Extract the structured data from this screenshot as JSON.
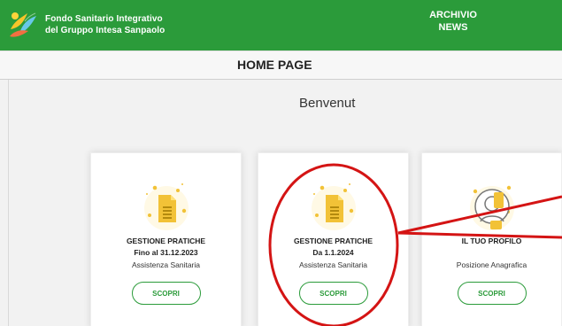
{
  "header": {
    "brand_line_1": "Fondo Sanitario Integrativo",
    "brand_line_2": "del Gruppo Intesa Sanpaolo",
    "nav_line_1": "ARCHIVIO",
    "nav_line_2": "NEWS"
  },
  "homebar": {
    "title": "HOME PAGE"
  },
  "main": {
    "welcome": "Benvenut"
  },
  "cards": [
    {
      "title": "GESTIONE PRATICHE",
      "subtitle": "Fino al 31.12.2023",
      "description": "Assistenza Sanitaria",
      "button": "SCOPRI",
      "icon": "document-icon"
    },
    {
      "title": "GESTIONE PRATICHE",
      "subtitle": "Da 1.1.2024",
      "description": "Assistenza Sanitaria",
      "button": "SCOPRI",
      "icon": "document-icon"
    },
    {
      "title": "IL TUO PROFILO",
      "subtitle": "",
      "description": "Posizione Anagrafica",
      "button": "SCOPRI",
      "icon": "user-profile-icon"
    }
  ],
  "colors": {
    "header_green": "#2b9b3a",
    "annotation_red": "#d41414",
    "icon_yellow": "#f2c237"
  }
}
